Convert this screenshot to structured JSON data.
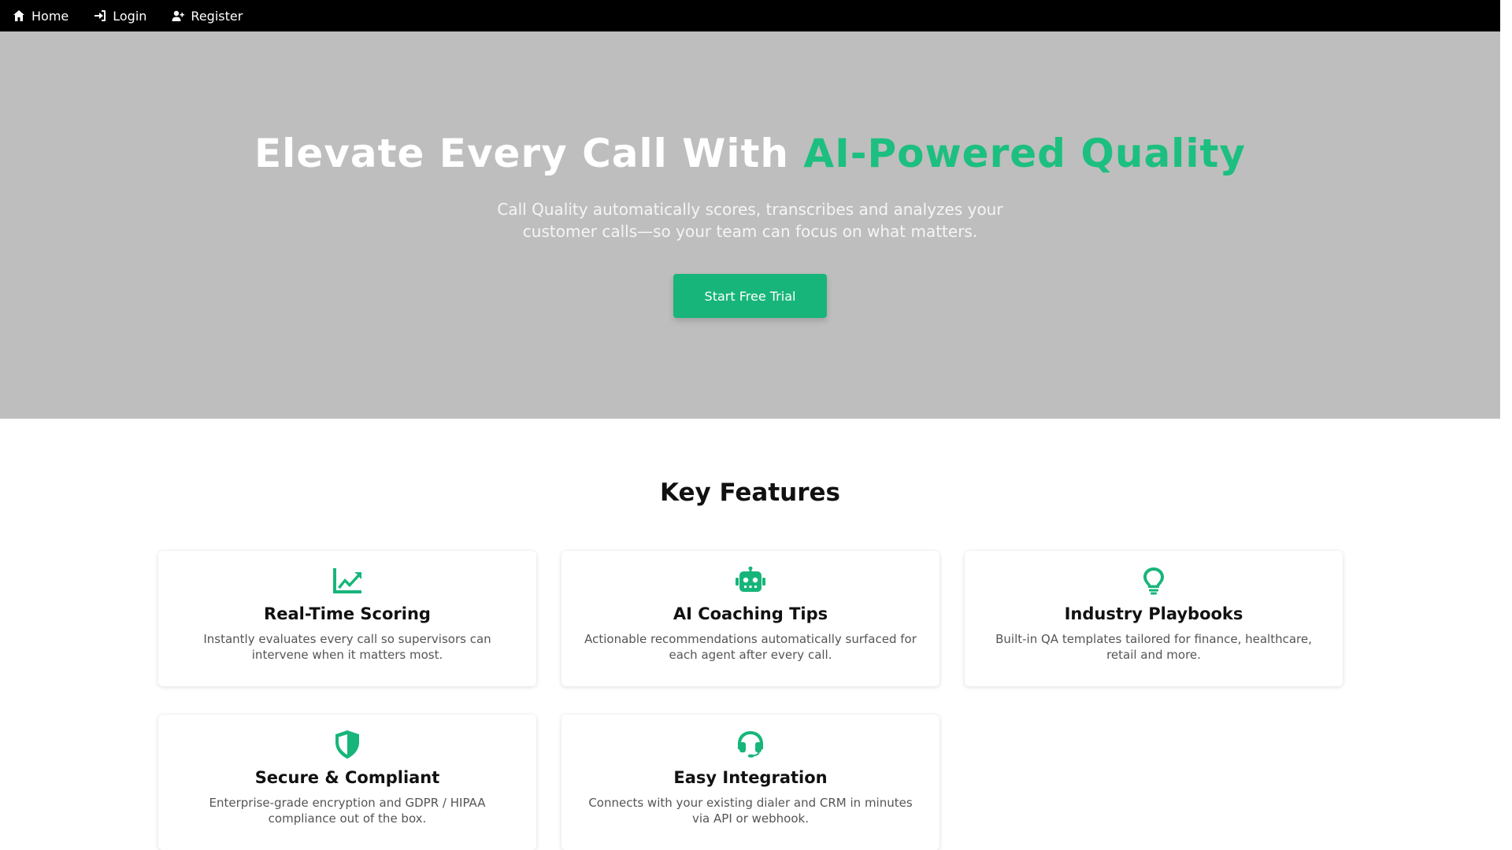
{
  "nav": {
    "items": [
      {
        "label": "Home",
        "icon": "home-icon"
      },
      {
        "label": "Login",
        "icon": "login-icon"
      },
      {
        "label": "Register",
        "icon": "user-plus-icon"
      }
    ]
  },
  "hero": {
    "title_main": "Elevate Every Call With ",
    "title_accent": "AI-Powered Quality",
    "subtitle": "Call Quality automatically scores, transcribes and analyzes your customer calls—so your team can focus on what matters.",
    "cta_label": "Start Free Trial"
  },
  "features": {
    "title": "Key Features",
    "items": [
      {
        "icon": "chart-line-icon",
        "title": "Real-Time Scoring",
        "desc": "Instantly evaluates every call so supervisors can intervene when it matters most."
      },
      {
        "icon": "robot-icon",
        "title": "AI Coaching Tips",
        "desc": "Actionable recommendations automatically surfaced for each agent after every call."
      },
      {
        "icon": "lightbulb-icon",
        "title": "Industry Playbooks",
        "desc": "Built-in QA templates tailored for finance, healthcare, retail and more."
      },
      {
        "icon": "shield-icon",
        "title": "Secure & Compliant",
        "desc": "Enterprise-grade encryption and GDPR / HIPAA compliance out of the box."
      },
      {
        "icon": "headset-icon",
        "title": "Easy Integration",
        "desc": "Connects with your existing dialer and CRM in minutes via API or webhook."
      }
    ]
  },
  "colors": {
    "accent": "#1cbf7f",
    "button": "#17b57a",
    "hero_bg": "#bebebe",
    "nav_bg": "#000000"
  }
}
